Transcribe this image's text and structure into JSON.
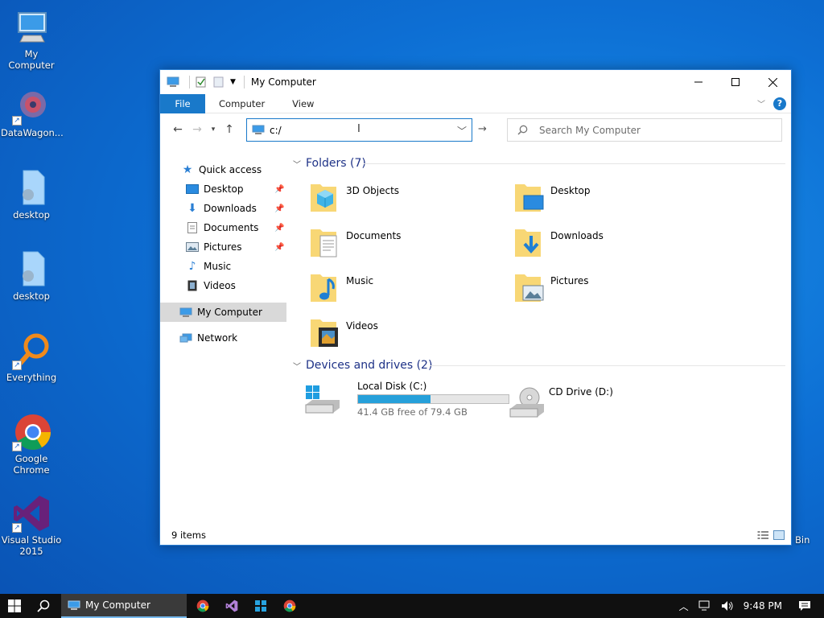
{
  "desktop": {
    "icons": [
      {
        "label": "My Computer"
      },
      {
        "label": "DataWagon..."
      },
      {
        "label": "desktop"
      },
      {
        "label": "desktop"
      },
      {
        "label": "Everything"
      },
      {
        "label": "Google Chrome"
      },
      {
        "label": "Visual Studio 2015"
      }
    ],
    "bin_label": "Bin"
  },
  "window": {
    "title": "My Computer",
    "ribbon": {
      "file": "File",
      "computer": "Computer",
      "view": "View",
      "help": "?"
    },
    "address": {
      "value": "c:/"
    },
    "search": {
      "placeholder": "Search My Computer"
    },
    "nav": {
      "quick_access": "Quick access",
      "items": [
        "Desktop",
        "Downloads",
        "Documents",
        "Pictures",
        "Music",
        "Videos"
      ],
      "my_computer": "My Computer",
      "network": "Network"
    },
    "folders_header": "Folders (7)",
    "folders": [
      "3D Objects",
      "Desktop",
      "Documents",
      "Downloads",
      "Music",
      "Pictures",
      "Videos"
    ],
    "drives_header": "Devices and drives (2)",
    "drives": [
      {
        "name": "Local Disk (C:)",
        "free": "41.4 GB free of 79.4 GB",
        "used_fraction": 0.48
      },
      {
        "name": "CD Drive (D:)"
      }
    ],
    "status": "9 items"
  },
  "taskbar": {
    "active_window": "My Computer",
    "time": "9:48 PM"
  }
}
